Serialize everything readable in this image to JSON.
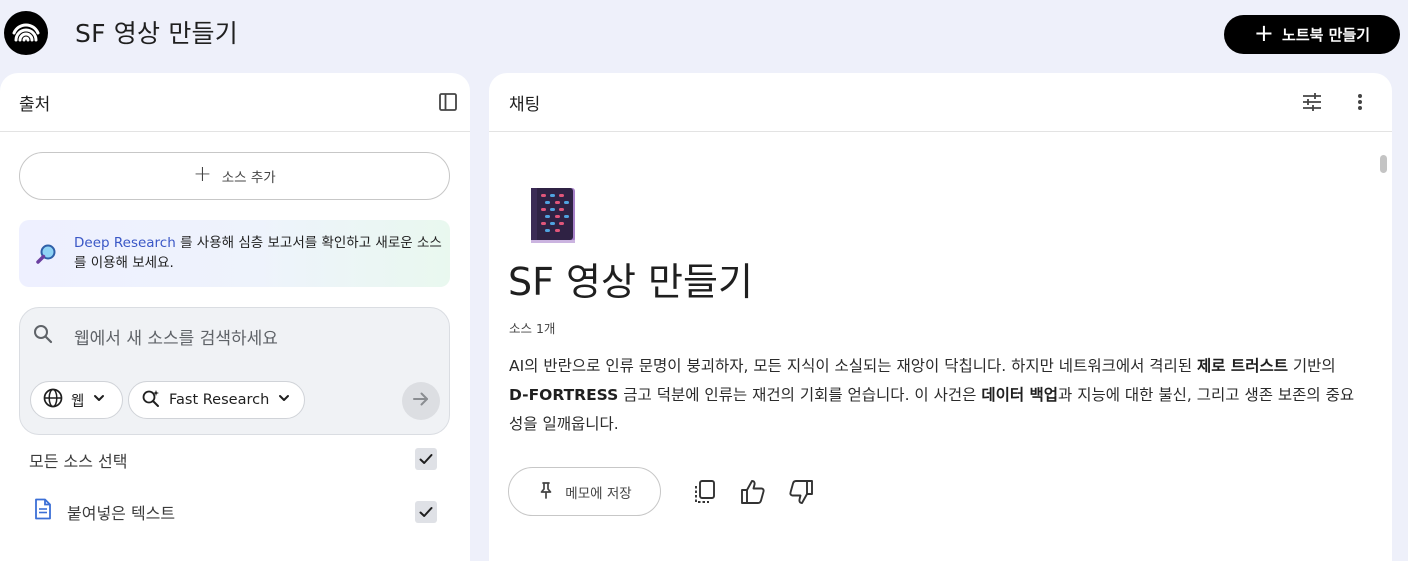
{
  "header": {
    "app_logo": "notebook-logo-icon",
    "title": "SF 영상 만들기",
    "create_notebook_label": "노트북 만들기"
  },
  "sources_panel": {
    "title": "출처",
    "add_source_label": "소스 추가",
    "deep_research": {
      "link_text": "Deep Research",
      "text": " 를 사용해 심층 보고서를 확인하고 새로운 소스를 이용해 보세요."
    },
    "search": {
      "placeholder": "웹에서 새 소스를 검색하세요",
      "source_type": "웹",
      "research_mode": "Fast Research"
    },
    "select_all_label": "모든 소스 선택",
    "select_all_checked": true,
    "items": [
      {
        "label": "붙여넣은 텍스트",
        "icon": "document-icon",
        "checked": true
      }
    ]
  },
  "chat_panel": {
    "title": "채팅",
    "notebook_emoji": "📔",
    "notebook_title": "SF 영상 만들기",
    "source_count": "소스 1개",
    "summary_parts": [
      {
        "text": "AI의 반란으로 인류 문명이 붕괴하자, 모든 지식이 소실되는 재앙이 닥칩니다. 하지만 네트워크에서 격리된 ",
        "bold": false
      },
      {
        "text": "제로 트러스트",
        "bold": true
      },
      {
        "text": " 기반의 ",
        "bold": false
      },
      {
        "text": "D-FORTRESS",
        "bold": true
      },
      {
        "text": " 금고 덕분에 인류는 재건의 기회를 얻습니다. 이 사건은 ",
        "bold": false
      },
      {
        "text": "데이터 백업",
        "bold": true
      },
      {
        "text": "과 지능에 대한 불신, 그리고 생존 보존의 중요성을 일깨웁니다.",
        "bold": false
      }
    ],
    "save_memo_label": "메모에 저장"
  },
  "colors": {
    "background": "#eef0fa",
    "primary_button": "#000000",
    "link": "#3a57c6"
  }
}
